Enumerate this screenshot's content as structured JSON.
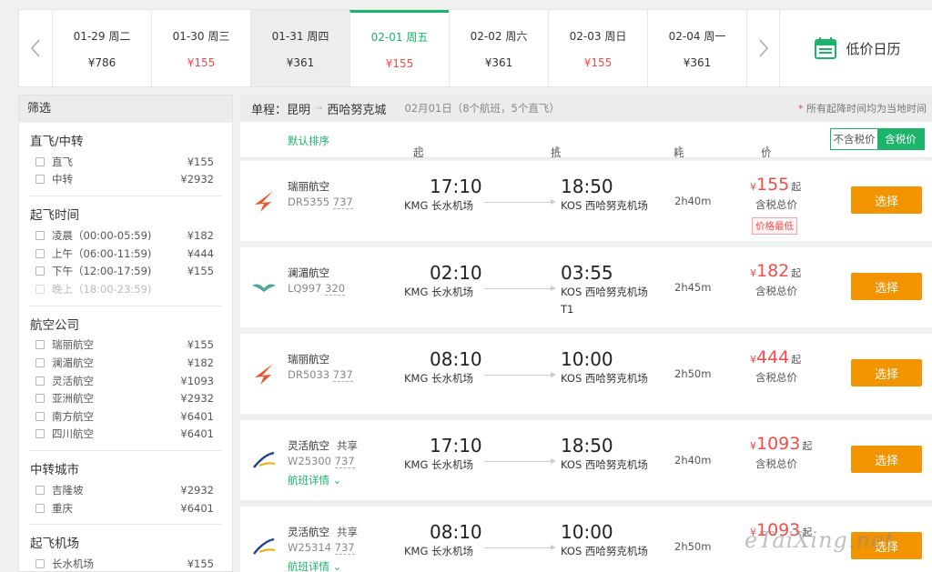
{
  "dates": [
    {
      "date": "01-29 周二",
      "price": "¥786",
      "low": false
    },
    {
      "date": "01-30 周三",
      "price": "¥155",
      "low": true
    },
    {
      "date": "01-31 周四",
      "price": "¥361",
      "low": false
    },
    {
      "date": "02-01 周五",
      "price": "¥155",
      "low": true
    },
    {
      "date": "02-02 周六",
      "price": "¥361",
      "low": false
    },
    {
      "date": "02-03 周日",
      "price": "¥155",
      "low": true
    },
    {
      "date": "02-04 周一",
      "price": "¥361",
      "low": false
    }
  ],
  "calendar_label": "低价日历",
  "sidebar": {
    "title": "筛选",
    "groups": [
      {
        "title": "直飞/中转",
        "options": [
          {
            "name": "直飞",
            "price": "¥155"
          },
          {
            "name": "中转",
            "price": "¥2932"
          }
        ]
      },
      {
        "title": "起飞时间",
        "options": [
          {
            "name": "凌晨（00:00-05:59)",
            "price": "¥182"
          },
          {
            "name": "上午（06:00-11:59)",
            "price": "¥444"
          },
          {
            "name": "下午（12:00-17:59)",
            "price": "¥155"
          },
          {
            "name": "晚上（18:00-23:59)",
            "price": "",
            "disabled": true
          }
        ]
      },
      {
        "title": "航空公司",
        "options": [
          {
            "name": "瑞丽航空",
            "price": "¥155"
          },
          {
            "name": "澜湄航空",
            "price": "¥182"
          },
          {
            "name": "灵活航空",
            "price": "¥1093"
          },
          {
            "name": "亚洲航空",
            "price": "¥2932"
          },
          {
            "name": "南方航空",
            "price": "¥6401"
          },
          {
            "name": "四川航空",
            "price": "¥6401"
          }
        ]
      },
      {
        "title": "中转城市",
        "options": [
          {
            "name": "吉隆坡",
            "price": "¥2932"
          },
          {
            "name": "重庆",
            "price": "¥6401"
          }
        ]
      },
      {
        "title": "起飞机场",
        "options": [
          {
            "name": "长水机场",
            "price": "¥155"
          }
        ]
      }
    ]
  },
  "route": {
    "prefix": "单程：",
    "from": "昆明",
    "arrow": "→",
    "to": "西哈努克城",
    "sub": "02月01日（8个航班，5个直飞）",
    "note_star": "*",
    "note": "所有起降时间均为当地时间"
  },
  "sort": {
    "default": "默认排序",
    "depart": "起飞时间",
    "arrive": "抵达时间",
    "duration": "耗时",
    "price": "价格",
    "sort_mark": "⬆",
    "tax_off": "不含税价",
    "tax_on": "含税价"
  },
  "flights": [
    {
      "airline": "瑞丽航空",
      "share": "",
      "flight_no": "DR5355",
      "plane": "737",
      "dep_time": "17:10",
      "dep_airport": "KMG 长水机场",
      "arr_time": "18:50",
      "arr_airport": "KOS 西哈努克机场",
      "arr_terminal": "",
      "duration": "2h40m",
      "yen": "¥",
      "price": "155",
      "qi": "起",
      "tax": "含税总价",
      "badge": "价格最低",
      "detail": "",
      "button": "选择",
      "logo": "ruili-logo"
    },
    {
      "airline": "澜湄航空",
      "share": "",
      "flight_no": "LQ997",
      "plane": "320",
      "dep_time": "02:10",
      "dep_airport": "KMG 长水机场",
      "arr_time": "03:55",
      "arr_airport": "KOS 西哈努克机场",
      "arr_terminal": "T1",
      "duration": "2h45m",
      "yen": "¥",
      "price": "182",
      "qi": "起",
      "tax": "含税总价",
      "badge": "",
      "detail": "",
      "button": "选择",
      "logo": "lanmei-logo"
    },
    {
      "airline": "瑞丽航空",
      "share": "",
      "flight_no": "DR5033",
      "plane": "737",
      "dep_time": "08:10",
      "dep_airport": "KMG 长水机场",
      "arr_time": "10:00",
      "arr_airport": "KOS 西哈努克机场",
      "arr_terminal": "",
      "duration": "2h50m",
      "yen": "¥",
      "price": "444",
      "qi": "起",
      "tax": "含税总价",
      "badge": "",
      "detail": "",
      "button": "选择",
      "logo": "ruili-logo"
    },
    {
      "airline": "灵活航空",
      "share": "共享",
      "flight_no": "W25300",
      "plane": "737",
      "dep_time": "17:10",
      "dep_airport": "KMG 长水机场",
      "arr_time": "18:50",
      "arr_airport": "KOS 西哈努克机场",
      "arr_terminal": "",
      "duration": "2h40m",
      "yen": "¥",
      "price": "1093",
      "qi": "起",
      "tax": "含税总价",
      "badge": "",
      "detail": "航班详情",
      "button": "选择",
      "logo": "linghuo-logo"
    },
    {
      "airline": "灵活航空",
      "share": "共享",
      "flight_no": "W25314",
      "plane": "737",
      "dep_time": "08:10",
      "dep_airport": "KMG 长水机场",
      "arr_time": "10:00",
      "arr_airport": "KOS 西哈努克机场",
      "arr_terminal": "",
      "duration": "2h50m",
      "yen": "¥",
      "price": "1093",
      "qi": "起",
      "tax": "含税总价",
      "badge": "",
      "detail": "航班详情",
      "button": "选择",
      "logo": "linghuo-logo"
    }
  ],
  "watermark": "eTaiXing.net",
  "colors": {
    "accent": "#1cb36a",
    "price": "#f14c4c",
    "button": "#f29300"
  }
}
